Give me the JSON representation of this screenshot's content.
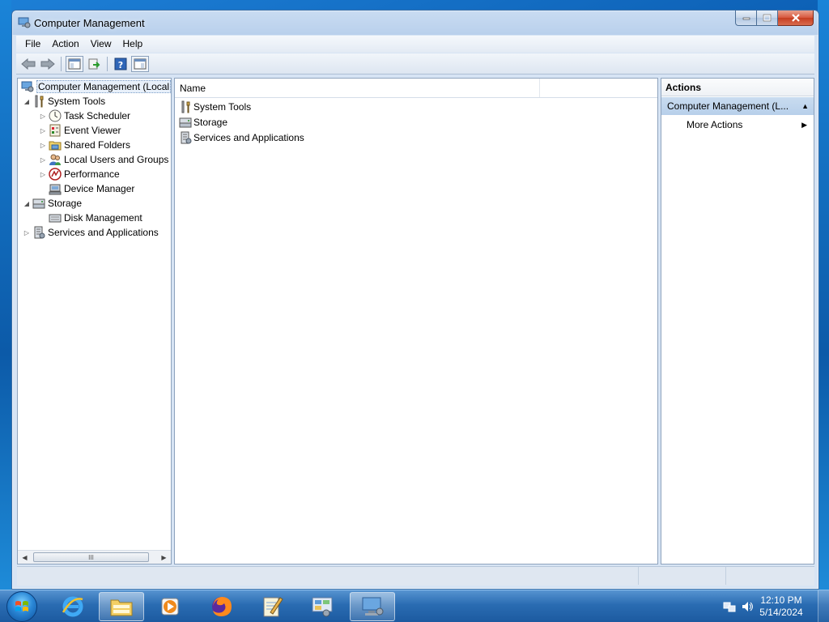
{
  "window": {
    "title": "Computer Management",
    "minimize_icon": "minimize-icon",
    "maximize_icon": "maximize-icon",
    "close_icon": "close-icon"
  },
  "menubar": {
    "items": [
      {
        "label": "File"
      },
      {
        "label": "Action"
      },
      {
        "label": "View"
      },
      {
        "label": "Help"
      }
    ]
  },
  "toolbar": {
    "buttons": [
      "back-arrow-icon",
      "forward-arrow-icon",
      "show-hide-console-tree-icon",
      "export-list-icon",
      "help-icon",
      "show-hide-action-pane-icon"
    ]
  },
  "tree": {
    "root": "Computer Management (Local",
    "items": [
      {
        "label": "System Tools",
        "icon": "tools-icon",
        "expanded": true
      },
      {
        "label": "Task Scheduler",
        "icon": "clock-icon",
        "collapsed": true
      },
      {
        "label": "Event Viewer",
        "icon": "event-viewer-icon",
        "collapsed": true
      },
      {
        "label": "Shared Folders",
        "icon": "shared-folder-icon",
        "collapsed": true
      },
      {
        "label": "Local Users and Groups",
        "icon": "users-icon",
        "collapsed": true
      },
      {
        "label": "Performance",
        "icon": "performance-icon",
        "collapsed": true
      },
      {
        "label": "Device Manager",
        "icon": "device-manager-icon"
      },
      {
        "label": "Storage",
        "icon": "storage-icon",
        "expanded": true
      },
      {
        "label": "Disk Management",
        "icon": "disk-icon"
      },
      {
        "label": "Services and Applications",
        "icon": "services-icon",
        "collapsed": true
      }
    ],
    "scroll_grip": "III"
  },
  "list": {
    "column_name": "Name",
    "rows": [
      {
        "label": "System Tools",
        "icon": "tools-icon"
      },
      {
        "label": "Storage",
        "icon": "storage-icon"
      },
      {
        "label": "Services and Applications",
        "icon": "services-icon"
      }
    ]
  },
  "actions": {
    "header": "Actions",
    "section": "Computer Management (L...",
    "item": "More Actions"
  },
  "taskbar": {
    "apps": [
      "ie-icon",
      "file-explorer-icon",
      "media-player-icon",
      "firefox-icon",
      "notepad-icon",
      "control-panel-icon",
      "computer-management-icon"
    ],
    "time": "12:10 PM",
    "date": "5/14/2024"
  },
  "colors": {
    "selection": "#c9dcf0",
    "taskbar": "#2a6cb2",
    "window_frame": "#b9d0ec"
  }
}
